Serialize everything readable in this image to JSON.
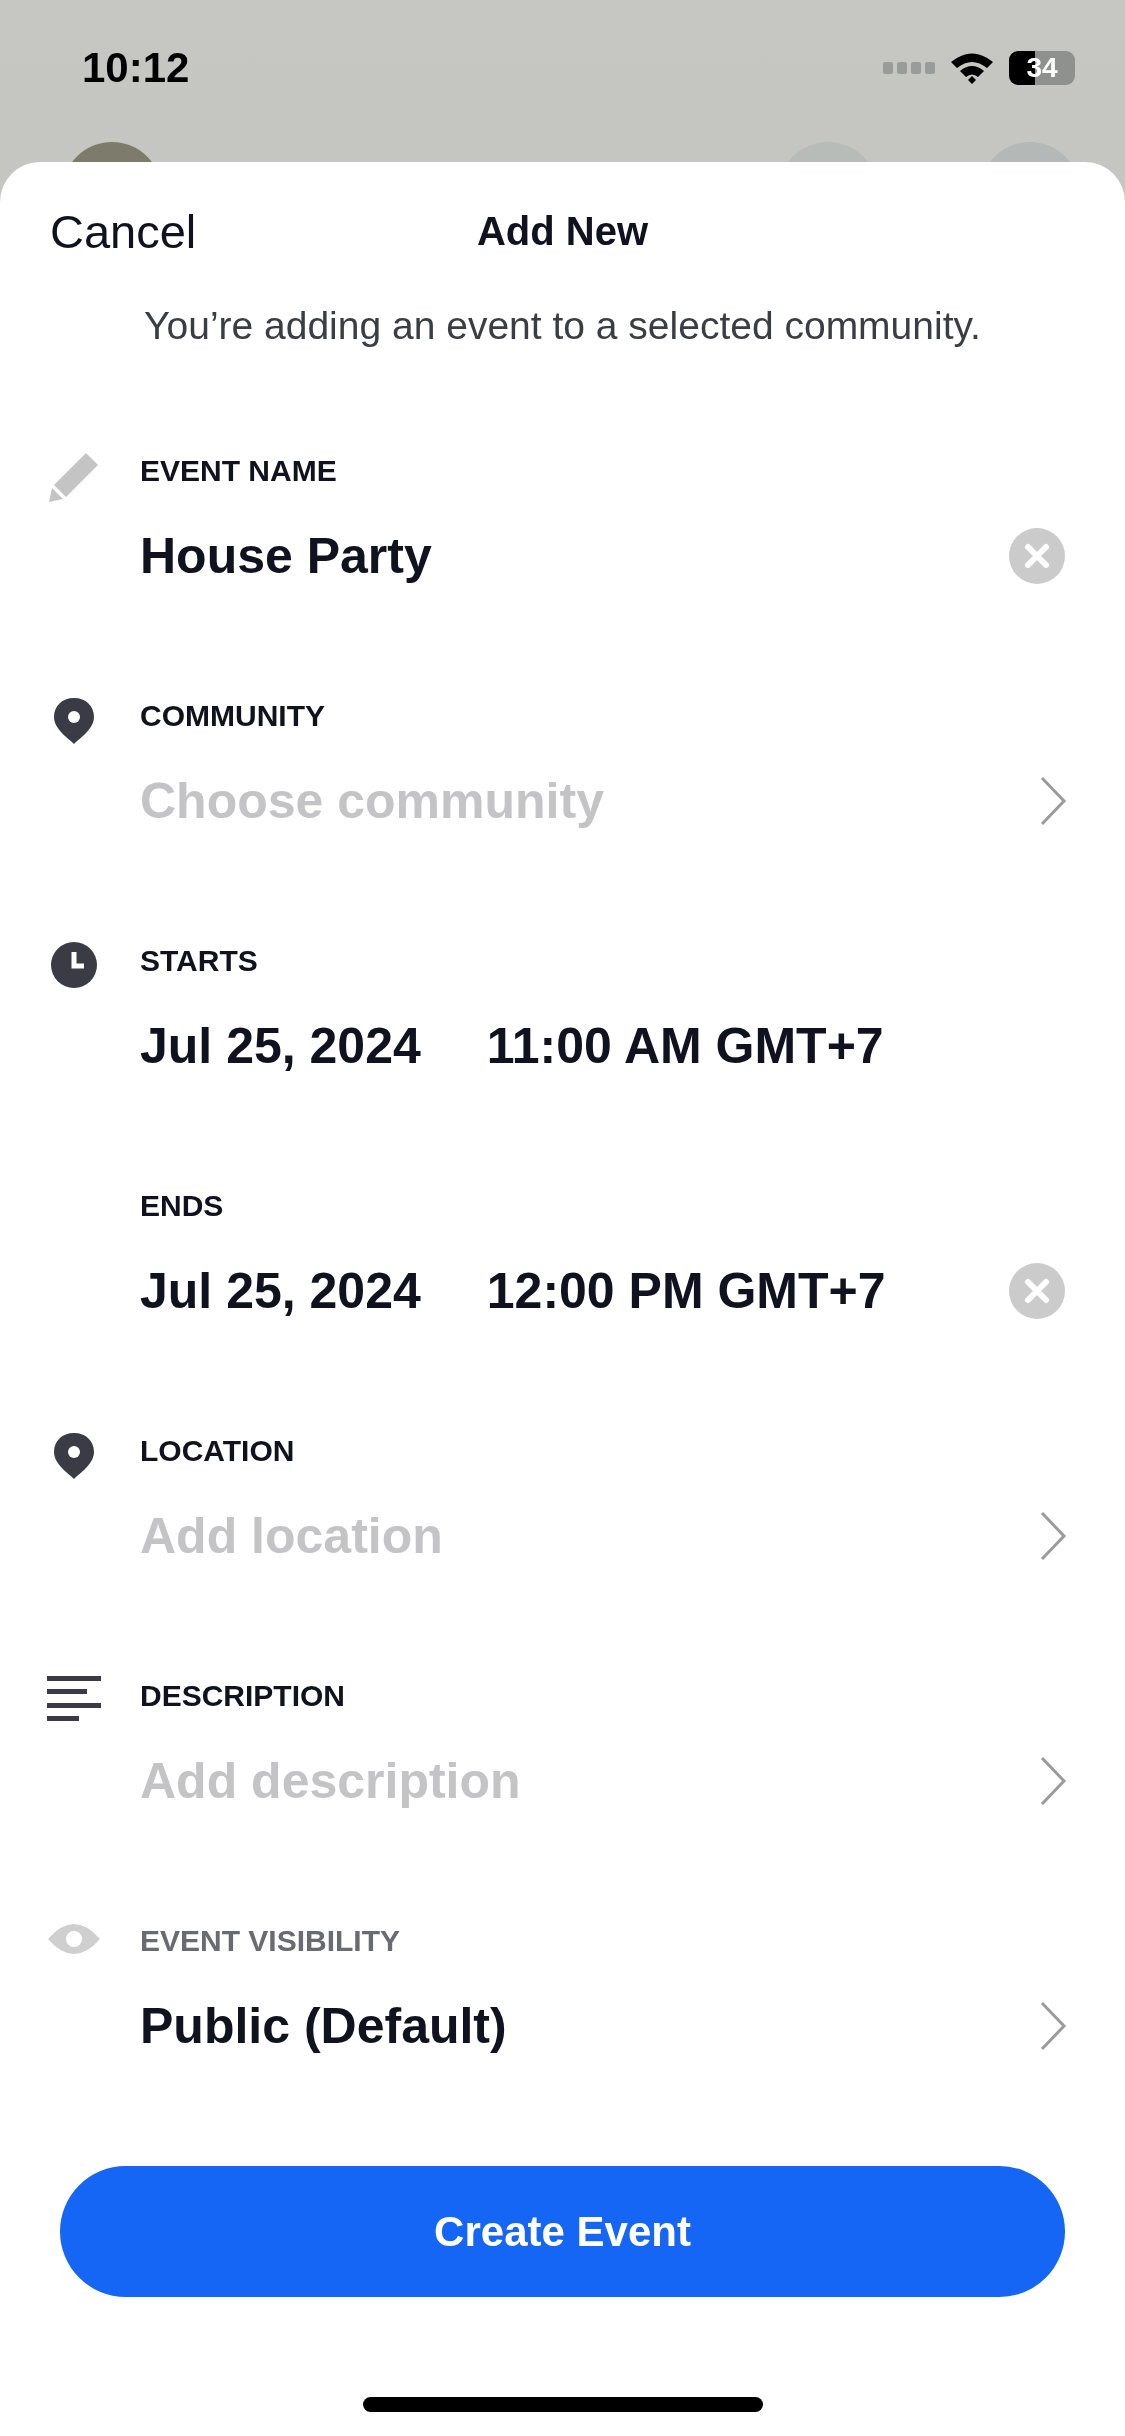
{
  "status_bar": {
    "time": "10:12",
    "battery": "34"
  },
  "header": {
    "cancel": "Cancel",
    "title": "Add New"
  },
  "subtitle": "You’re adding an event to a selected community.",
  "fields": [
    {
      "kind": "text",
      "label": "EVENT NAME",
      "value": "House Party"
    },
    {
      "kind": "picker",
      "label": "COMMUNITY",
      "placeholder": "Choose community"
    },
    {
      "kind": "datetime",
      "label": "STARTS",
      "date": "Jul 25, 2024",
      "time": "11:00 AM GMT+7"
    },
    {
      "kind": "datetime_clear",
      "label": "ENDS",
      "date": "Jul 25, 2024",
      "time": "12:00 PM GMT+7"
    },
    {
      "kind": "picker",
      "label": "LOCATION",
      "placeholder": "Add location"
    },
    {
      "kind": "picker",
      "label": "DESCRIPTION",
      "placeholder": "Add description"
    },
    {
      "kind": "visibility",
      "label": "EVENT VISIBILITY",
      "value": "Public (Default)"
    }
  ],
  "button": "Create Event"
}
